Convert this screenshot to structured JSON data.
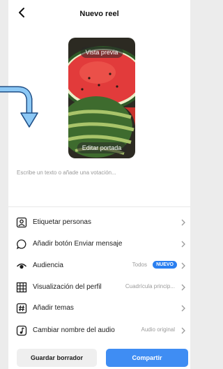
{
  "header": {
    "title": "Nuevo reel"
  },
  "preview": {
    "top_label": "Vista previa",
    "bottom_label": "Editar portada"
  },
  "caption": {
    "placeholder": "Escribe un texto o añade una votación..."
  },
  "options": [
    {
      "label": "Etiquetar personas",
      "icon": "tag-person-icon"
    },
    {
      "label": "Añadir botón Enviar mensaje",
      "icon": "message-bubble-icon"
    },
    {
      "label": "Audiencia",
      "icon": "eye-icon",
      "value": "Todos",
      "badge": "NUEVO"
    },
    {
      "label": "Visualización del perfil",
      "icon": "grid-icon",
      "value": "Cuadrícula princip..."
    },
    {
      "label": "Añadir temas",
      "icon": "hashtag-icon"
    },
    {
      "label": "Cambiar nombre del audio",
      "icon": "music-note-icon",
      "value": "Audio original"
    }
  ],
  "actions": {
    "draft_label": "Guardar borrador",
    "share_label": "Compartir"
  },
  "colors": {
    "accent_blue": "#3f8df3",
    "badge_blue": "#2a7ff0",
    "annotation_arrow": "#5fa9ea"
  }
}
